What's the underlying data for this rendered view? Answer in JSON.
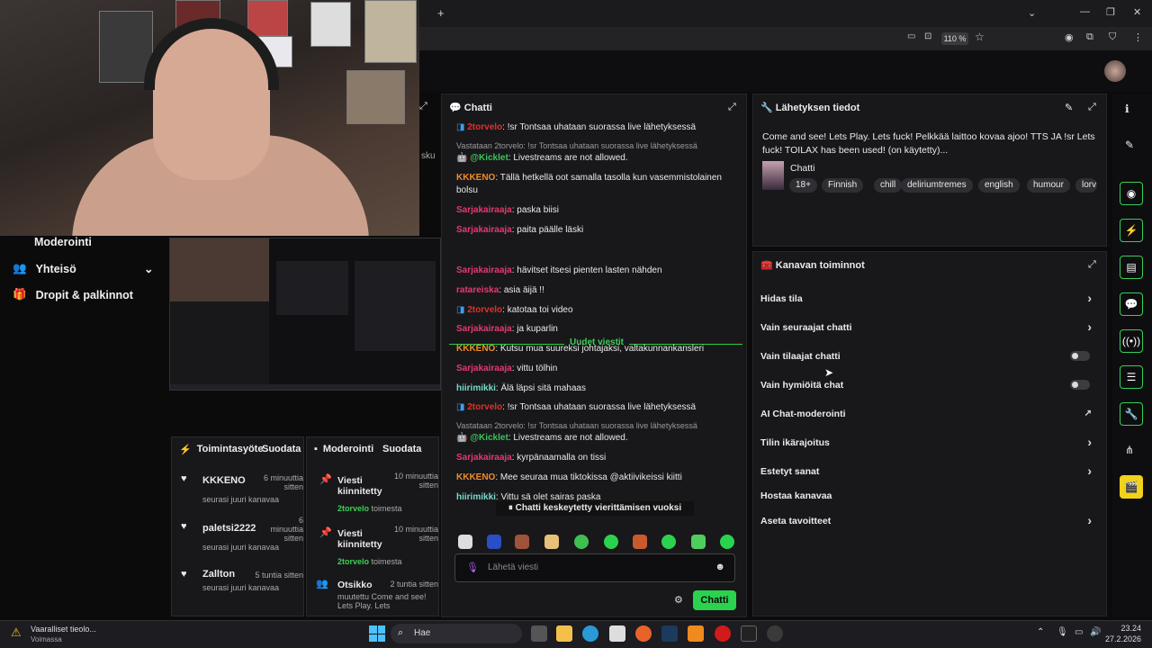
{
  "browser": {
    "zoom": "110 %",
    "new_tab": "+",
    "win_min": "—",
    "win_max": "❐",
    "win_close": "✕"
  },
  "left_nav": {
    "items": [
      {
        "label": "Moderointi"
      },
      {
        "label": "Yhteisö"
      },
      {
        "label": "Dropit & palkinnot"
      }
    ]
  },
  "activity_panel": {
    "title": "Toimintasyöte",
    "filter": "Suodata",
    "items": [
      {
        "user": "KKKENO",
        "time": "6 minuuttia sitten",
        "action": "seurasi juuri kanavaa"
      },
      {
        "user": "paletsi2222",
        "time": "6 minuuttia sitten",
        "action": "seurasi juuri kanavaa"
      },
      {
        "user": "Zallton",
        "time": "5 tuntia sitten",
        "action": "seurasi juuri kanavaa"
      }
    ]
  },
  "mod_panel": {
    "title": "Moderointi",
    "filter": "Suodata",
    "items": [
      {
        "action": "Viesti kiinnitetty",
        "time": "10 minuuttia sitten",
        "by": "2torvelo",
        "suffix": "toimesta"
      },
      {
        "action": "Viesti kiinnitetty",
        "time": "10 minuuttia sitten",
        "by": "2torvelo",
        "suffix": "toimesta"
      },
      {
        "action": "Otsikko",
        "time": "2 tuntia sitten",
        "detail": "muutettu Come and see! Lets Play. Lets"
      }
    ]
  },
  "chat": {
    "title": "Chatti",
    "messages": [
      {
        "user": "2torvelo",
        "text": "!sr Tontsaa uhataan suorassa live lähetyksessä",
        "color": "#e0312a"
      },
      {
        "reply": "Vastataan 2torvelo: !sr Tontsaa uhataan suorassa live lähetyksessä"
      },
      {
        "user": "@Kicklet",
        "text": "Livestreams are not allowed.",
        "color": "#39c45a"
      },
      {
        "user": "KKKENO",
        "text": "Tällä hetkellä oot samalla tasolla kun vasemmistolainen bolsu",
        "color": "#f08c2a"
      },
      {
        "user": "Sarjakairaaja",
        "text": "paska biisi",
        "color": "#e43a6f"
      },
      {
        "user": "Sarjakairaaja",
        "text": "paita päälle läski",
        "color": "#e43a6f"
      },
      {
        "user": "Sarjakairaaja",
        "text": "hävitset itsesi pienten lasten nähden",
        "color": "#e43a6f"
      },
      {
        "user": "ratareiska",
        "text": "asia äijä !!",
        "color": "#e43a6f"
      },
      {
        "user": "2torvelo",
        "text": "katotaa toi video",
        "color": "#e0312a"
      },
      {
        "user": "Sarjakairaaja",
        "text": "ja kuparlin",
        "color": "#e43a6f"
      },
      {
        "user": "KKKENO",
        "text": "Kutsu mua suureksi johtajaksi, valtakunnankansleri",
        "color": "#f08c2a"
      },
      {
        "user": "Sarjakairaaja",
        "text": "vittu tölhin",
        "color": "#e43a6f"
      },
      {
        "user": "hiirimikki",
        "text": "Älä läpsi sitä mahaas",
        "color": "#7ad9c9"
      },
      {
        "user": "2torvelo",
        "text": "!sr Tontsaa uhataan suorassa live lähetyksessä",
        "color": "#e0312a"
      },
      {
        "reply": "Vastataan 2torvelo: !sr Tontsaa uhataan suorassa live lähetyksessä"
      },
      {
        "user": "@Kicklet",
        "text": "Livestreams are not allowed.",
        "color": "#39c45a"
      },
      {
        "user": "Sarjakairaaja",
        "text": "kyrpänaamalla on tissi",
        "color": "#e43a6f"
      },
      {
        "user": "KKKENO",
        "text": "Mee seuraa mua tiktokissa @aktiivikeissi kiitti",
        "color": "#f08c2a"
      },
      {
        "user": "hiirimikki",
        "text": "Vittu sä olet sairas paska",
        "color": "#7ad9c9"
      }
    ],
    "new_messages": "Uudet viestit",
    "paused": "Chatti keskeytetty vierittämisen vuoksi",
    "input_placeholder": "Lähetä viesti",
    "send_label": "Chatti"
  },
  "stream_info": {
    "title": "Lähetyksen tiedot",
    "description": "Come and see! Lets Play. Lets fuck! Pelkkää laittoo kovaa ajoo! TTS JA !sr Lets fuck! TOILAX has been used! (on käytetty)...",
    "category": "Chatti",
    "tags": [
      "18+",
      "Finnish",
      "chill",
      "deliriumtremes",
      "english",
      "humour",
      "lorv"
    ]
  },
  "channel_actions": {
    "title": "Kanavan toiminnot",
    "rows": [
      {
        "label": "Hidas tila",
        "control": "chevron"
      },
      {
        "label": "Vain seuraajat chatti",
        "control": "chevron"
      },
      {
        "label": "Vain tilaajat chatti",
        "control": "toggle"
      },
      {
        "label": "Vain hymiöitä chat",
        "control": "toggle"
      },
      {
        "label": "AI Chat-moderointi",
        "control": "external"
      },
      {
        "label": "Tilin ikärajoitus",
        "control": "chevron"
      },
      {
        "label": "Estetyt sanat",
        "control": "chevron"
      },
      {
        "label": "Hostaa kanavaa",
        "control": "none"
      },
      {
        "label": "Aseta tavoitteet",
        "control": "chevron"
      }
    ]
  },
  "taskbar": {
    "warning_title": "Vaaralliset tieolo...",
    "warning_sub": "Voimassa",
    "search": "Hae",
    "time": "23.24",
    "date": "27.2.2026"
  }
}
